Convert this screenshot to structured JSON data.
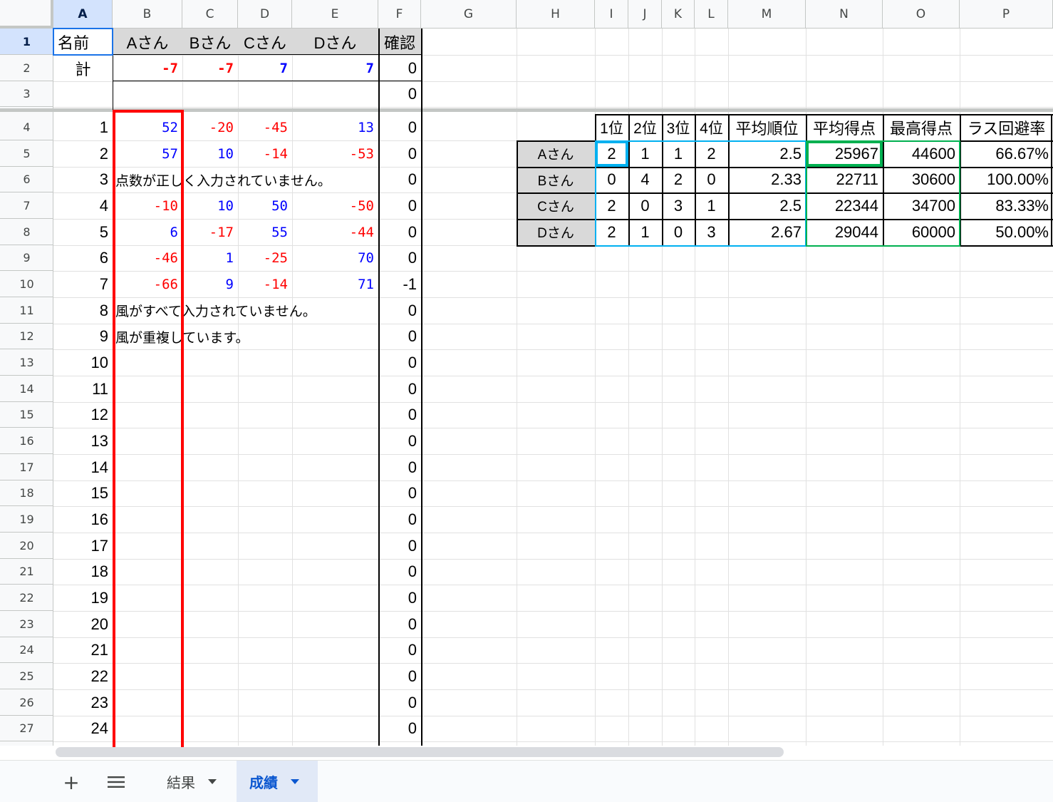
{
  "spreadsheet": {
    "column_headers": [
      "A",
      "B",
      "C",
      "D",
      "E",
      "F",
      "G",
      "H",
      "I",
      "J",
      "K",
      "L",
      "M",
      "N",
      "O",
      "P"
    ],
    "row_numbers": [
      "1",
      "2",
      "3",
      "4",
      "5",
      "6",
      "7",
      "8",
      "9",
      "10",
      "11",
      "12",
      "13",
      "14",
      "15",
      "16",
      "17",
      "18",
      "19",
      "20",
      "21",
      "22",
      "23",
      "24",
      "25",
      "26",
      "27"
    ],
    "selected_cell": "A1",
    "header_row": {
      "name_label": "名前",
      "players": [
        "Aさん",
        "Bさん",
        "Cさん",
        "Dさん"
      ],
      "check_label": "確認"
    },
    "total_row": {
      "label": "計",
      "values": [
        "-7",
        "-7",
        "7",
        "7"
      ],
      "check": "0"
    },
    "row3_check": "0",
    "games": [
      {
        "num": "1",
        "scores": [
          "52",
          "-20",
          "-45",
          "13"
        ],
        "message": "",
        "check": "0"
      },
      {
        "num": "2",
        "scores": [
          "57",
          "10",
          "-14",
          "-53"
        ],
        "message": "",
        "check": "0"
      },
      {
        "num": "3",
        "scores": [
          "",
          "",
          "",
          ""
        ],
        "message": "点数が正しく入力されていません。",
        "check": "0"
      },
      {
        "num": "4",
        "scores": [
          "-10",
          "10",
          "50",
          "-50"
        ],
        "message": "",
        "check": "0"
      },
      {
        "num": "5",
        "scores": [
          "6",
          "-17",
          "55",
          "-44"
        ],
        "message": "",
        "check": "0"
      },
      {
        "num": "6",
        "scores": [
          "-46",
          "1",
          "-25",
          "70"
        ],
        "message": "",
        "check": "0"
      },
      {
        "num": "7",
        "scores": [
          "-66",
          "9",
          "-14",
          "71"
        ],
        "message": "",
        "check": "-1"
      },
      {
        "num": "8",
        "scores": [
          "",
          "",
          "",
          ""
        ],
        "message": "風がすべて入力されていません。",
        "check": "0"
      },
      {
        "num": "9",
        "scores": [
          "",
          "",
          "",
          ""
        ],
        "message": "風が重複しています。",
        "check": "0"
      },
      {
        "num": "10",
        "scores": [
          "",
          "",
          "",
          ""
        ],
        "message": "",
        "check": "0"
      },
      {
        "num": "11",
        "scores": [
          "",
          "",
          "",
          ""
        ],
        "message": "",
        "check": "0"
      },
      {
        "num": "12",
        "scores": [
          "",
          "",
          "",
          ""
        ],
        "message": "",
        "check": "0"
      },
      {
        "num": "13",
        "scores": [
          "",
          "",
          "",
          ""
        ],
        "message": "",
        "check": "0"
      },
      {
        "num": "14",
        "scores": [
          "",
          "",
          "",
          ""
        ],
        "message": "",
        "check": "0"
      },
      {
        "num": "15",
        "scores": [
          "",
          "",
          "",
          ""
        ],
        "message": "",
        "check": "0"
      },
      {
        "num": "16",
        "scores": [
          "",
          "",
          "",
          ""
        ],
        "message": "",
        "check": "0"
      },
      {
        "num": "17",
        "scores": [
          "",
          "",
          "",
          ""
        ],
        "message": "",
        "check": "0"
      },
      {
        "num": "18",
        "scores": [
          "",
          "",
          "",
          ""
        ],
        "message": "",
        "check": "0"
      },
      {
        "num": "19",
        "scores": [
          "",
          "",
          "",
          ""
        ],
        "message": "",
        "check": "0"
      },
      {
        "num": "20",
        "scores": [
          "",
          "",
          "",
          ""
        ],
        "message": "",
        "check": "0"
      },
      {
        "num": "21",
        "scores": [
          "",
          "",
          "",
          ""
        ],
        "message": "",
        "check": "0"
      },
      {
        "num": "22",
        "scores": [
          "",
          "",
          "",
          ""
        ],
        "message": "",
        "check": "0"
      },
      {
        "num": "23",
        "scores": [
          "",
          "",
          "",
          ""
        ],
        "message": "",
        "check": "0"
      },
      {
        "num": "24",
        "scores": [
          "",
          "",
          "",
          ""
        ],
        "message": "",
        "check": "0"
      }
    ],
    "stats": {
      "headers": [
        "1位",
        "2位",
        "3位",
        "4位",
        "平均順位",
        "平均得点",
        "最高得点",
        "ラス回避率"
      ],
      "rows": [
        {
          "player": "Aさん",
          "values": [
            "2",
            "1",
            "1",
            "2",
            "2.5",
            "25967",
            "44600",
            "66.67%"
          ]
        },
        {
          "player": "Bさん",
          "values": [
            "0",
            "4",
            "2",
            "0",
            "2.33",
            "22711",
            "30600",
            "100.00%"
          ]
        },
        {
          "player": "Cさん",
          "values": [
            "2",
            "0",
            "3",
            "1",
            "2.5",
            "22344",
            "34700",
            "83.33%"
          ]
        },
        {
          "player": "Dさん",
          "values": [
            "2",
            "1",
            "0",
            "3",
            "2.67",
            "29044",
            "60000",
            "50.00%"
          ]
        }
      ]
    },
    "highlight_colors": {
      "red": "#ff0000",
      "blue": "#00b0f0",
      "green": "#00b050"
    }
  },
  "tabs": {
    "add_icon": "plus-icon",
    "menu_icon": "hamburger-icon",
    "sheets": [
      {
        "label": "結果",
        "active": false
      },
      {
        "label": "成績",
        "active": true
      }
    ]
  }
}
